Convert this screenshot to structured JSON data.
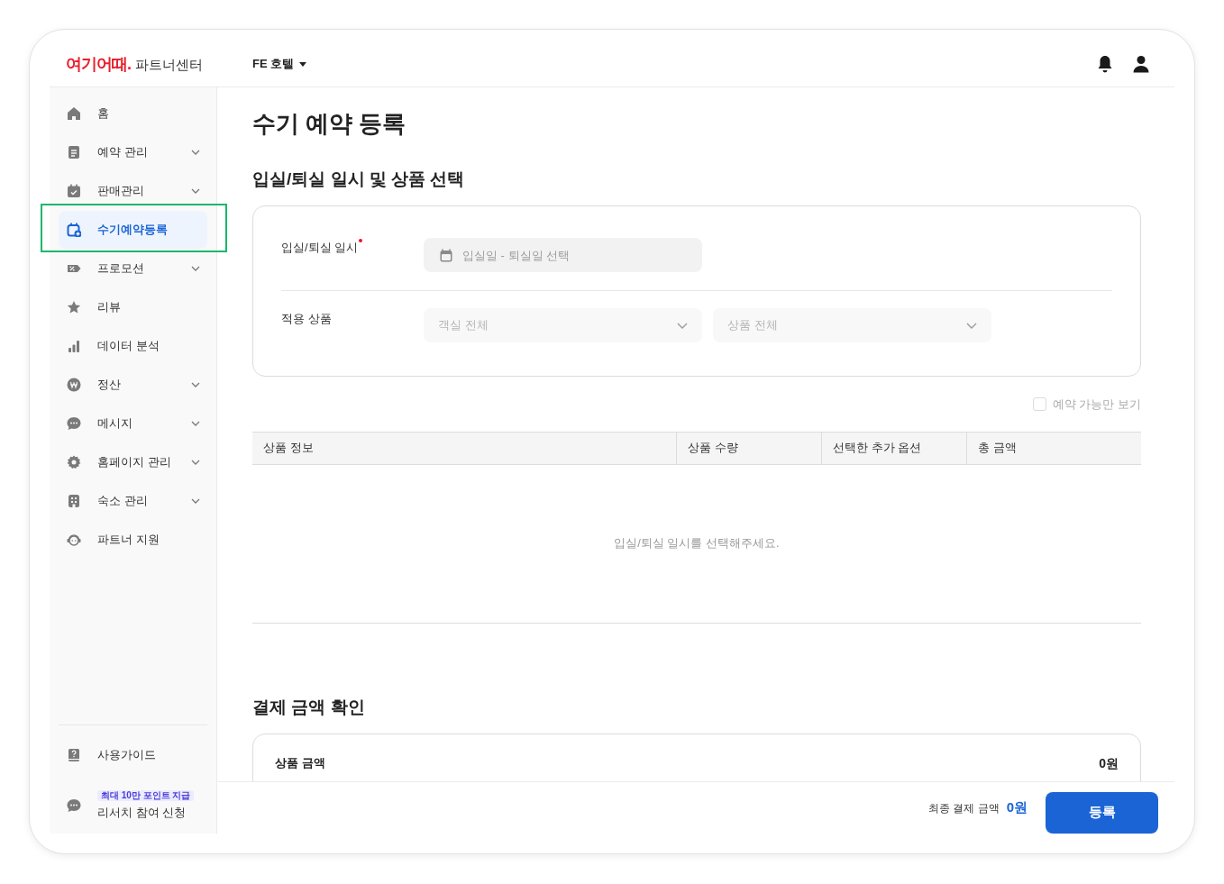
{
  "header": {
    "logo": "여기어때.",
    "logo_suffix": "파트너센터",
    "property": "FE 호텔"
  },
  "sidebar": {
    "items": [
      {
        "label": "홈",
        "has_submenu": false,
        "selected": false
      },
      {
        "label": "예약 관리",
        "has_submenu": true,
        "selected": false
      },
      {
        "label": "판매관리",
        "has_submenu": true,
        "selected": false
      },
      {
        "label": "수기예약등록",
        "has_submenu": false,
        "selected": true
      },
      {
        "label": "프로모션",
        "has_submenu": true,
        "selected": false
      },
      {
        "label": "리뷰",
        "has_submenu": false,
        "selected": false
      },
      {
        "label": "데이터 분석",
        "has_submenu": false,
        "selected": false
      },
      {
        "label": "정산",
        "has_submenu": true,
        "selected": false
      },
      {
        "label": "메시지",
        "has_submenu": true,
        "selected": false
      },
      {
        "label": "홈페이지 관리",
        "has_submenu": true,
        "selected": false
      },
      {
        "label": "숙소 관리",
        "has_submenu": true,
        "selected": false
      },
      {
        "label": "파트너 지원",
        "has_submenu": false,
        "selected": false
      }
    ],
    "bottom_items": [
      {
        "label": "사용가이드"
      },
      {
        "label": "리서치 참여 신청",
        "badge": "최대 10만 포인트 지급"
      }
    ]
  },
  "page_title": "수기 예약 등록",
  "selection_section": {
    "title": "입실/퇴실 일시 및 상품 선택",
    "date_row": {
      "label": "입실/퇴실 일시",
      "required": true,
      "placeholder": "입실일 - 퇴실일 선택"
    },
    "product_row": {
      "label": "적용 상품",
      "selects": [
        {
          "placeholder": "객실 전체",
          "disabled": true
        },
        {
          "placeholder": "상품 전체",
          "disabled": true
        }
      ]
    },
    "available_only": {
      "label": "예약 가능만 보기",
      "checked": false
    },
    "table": {
      "columns": [
        "상품 정보",
        "상품 수량",
        "선택한 추가 옵션",
        "총 금액"
      ],
      "empty_message": "입실/퇴실 일시를 선택해주세요."
    }
  },
  "payment_section": {
    "title": "결제 금액 확인",
    "rows": [
      {
        "label": "상품 금액",
        "value": "0원"
      }
    ]
  },
  "footer": {
    "total_label": "최종 결제 금액",
    "total_value": "0원",
    "submit": "등록"
  }
}
